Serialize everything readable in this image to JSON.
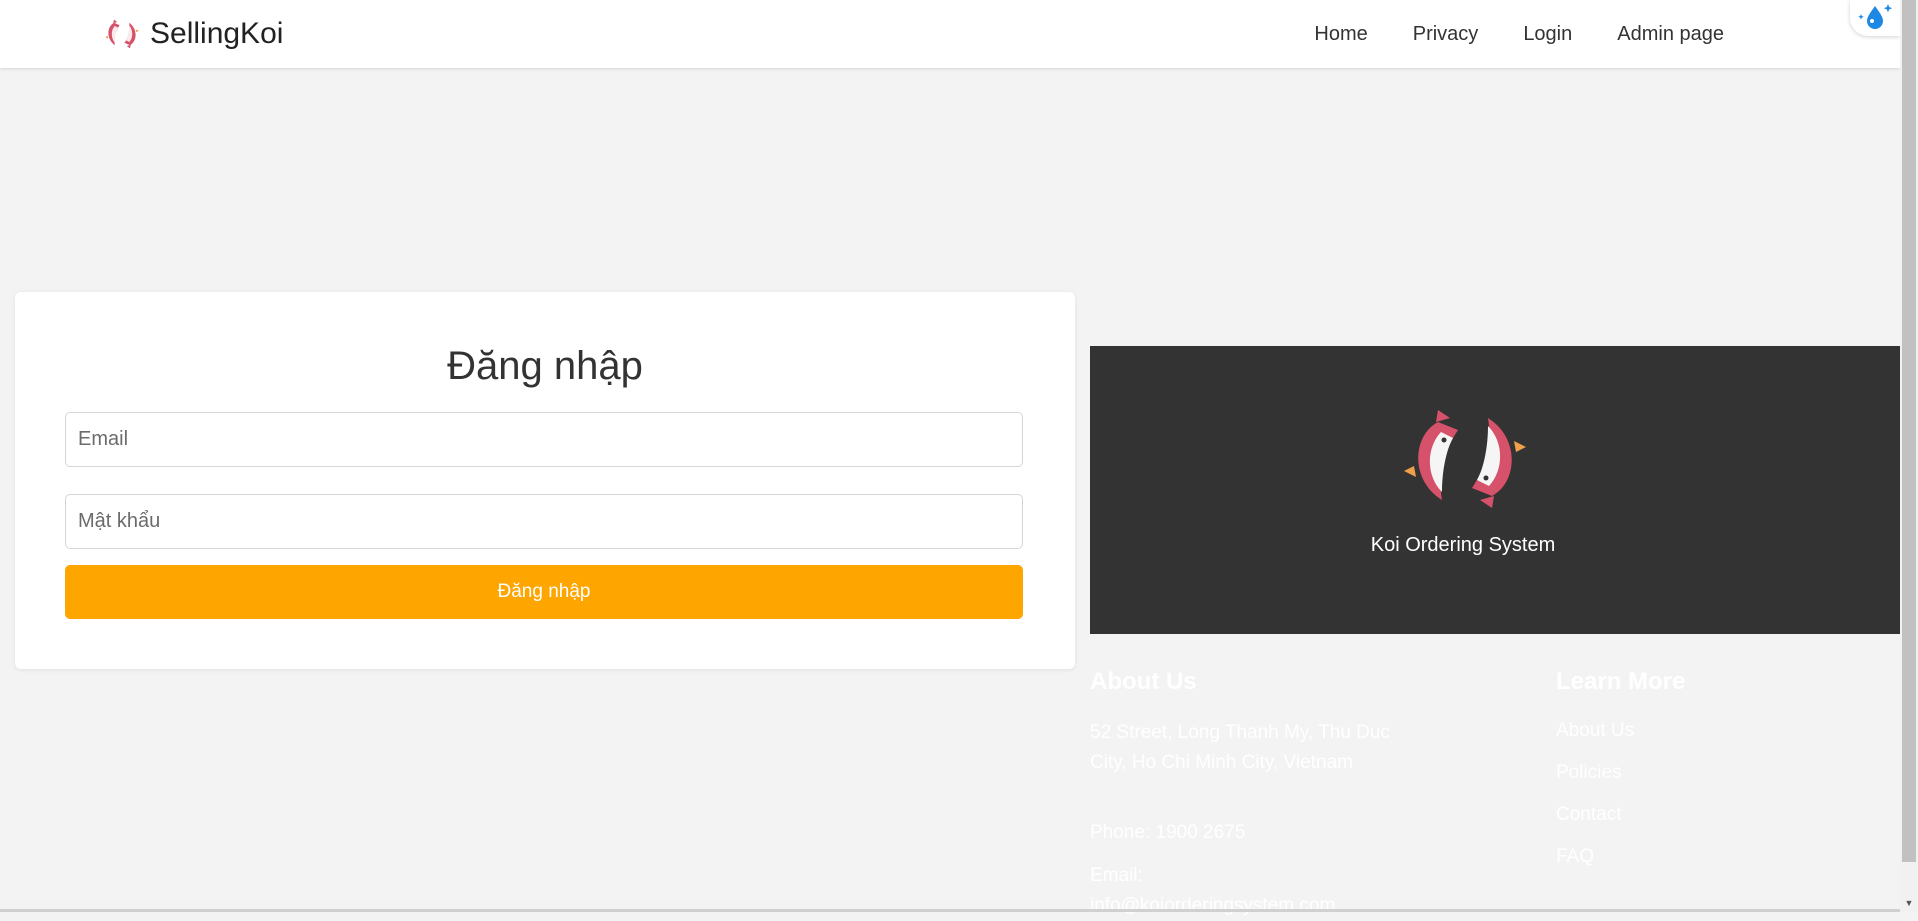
{
  "header": {
    "brand_name": "SellingKoi",
    "nav": {
      "home": "Home",
      "privacy": "Privacy",
      "login": "Login",
      "admin": "Admin page"
    }
  },
  "login": {
    "title": "Đăng nhập",
    "email_placeholder": "Email",
    "password_placeholder": "Mật khẩu",
    "submit_label": "Đăng nhập"
  },
  "promo": {
    "caption": "Koi Ordering System"
  },
  "footer": {
    "about": {
      "heading": "About Us",
      "address": "52 Street, Long Thanh My, Thu Duc City, Ho Chi Minh City, Vietnam",
      "phone": "Phone: 1900 2675",
      "email_label": "Email:",
      "email_value": "info@koiorderingsystem.com"
    },
    "learn_more": {
      "heading": "Learn More",
      "links": [
        "About Us",
        "Policies",
        "Contact",
        "FAQ"
      ]
    }
  },
  "colors": {
    "accent": "#ffa500",
    "dark_panel": "#333333",
    "koi_red": "#d6526a",
    "background": "#f3f3f3"
  },
  "icons": {
    "brand_logo": "koi-fish-icon",
    "extension": "water-drop-sparkle-icon"
  }
}
